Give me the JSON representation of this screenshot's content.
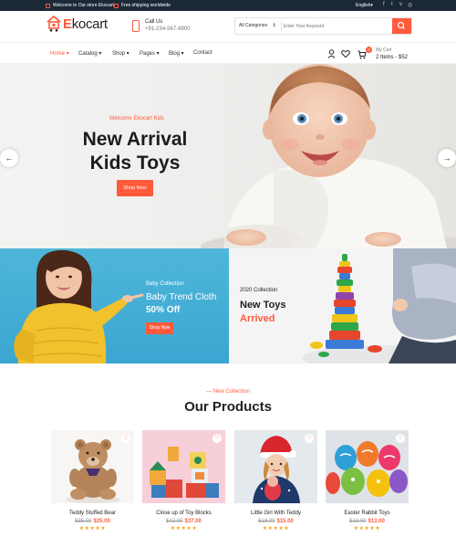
{
  "topbar": {
    "welcome": "Welcome to Our store Ekocart",
    "shipping": "Free shipping worldwide",
    "language": "English",
    "social_icons": [
      "facebook-icon",
      "twitter-icon",
      "vk-icon",
      "instagram-icon"
    ]
  },
  "header": {
    "logo_e": "E",
    "logo_rest": "kocart",
    "call_label": "Call Us",
    "phone": "+91-234-567-8900",
    "search": {
      "category": "All Categories",
      "placeholder": "Enter Your Keyword"
    }
  },
  "nav": {
    "items": [
      "Home",
      "Catalog",
      "Shop",
      "Pages",
      "Blog",
      "Contact"
    ],
    "active": "Home"
  },
  "cart": {
    "count": "2",
    "label": "My Cart",
    "amount": "2 Items - $52"
  },
  "hero": {
    "welcome": "Welcome Ekocart Kids",
    "title_line1": "New Arrival",
    "title_line2": "Kids Toys",
    "button": "Shop Now"
  },
  "banner_left": {
    "collection": "Baby Collection",
    "title": "Baby Trend Cloth",
    "offer": "50% Off",
    "button": "Shop Now"
  },
  "banner_right": {
    "collection": "2020 Collection",
    "title": "New Toys",
    "highlight": "Arrived"
  },
  "products_section": {
    "subtitle": "— New Collection",
    "title": "Our Products",
    "products": [
      {
        "name": "Teddy Stuffed Bear",
        "old_price": "$35.00",
        "price": "$25.00",
        "stars": "★★★★★"
      },
      {
        "name": "Close up of Toy Blocks",
        "old_price": "$42.00",
        "price": "$37.00",
        "stars": "★★★★★"
      },
      {
        "name": "Little Girl With Teddy",
        "old_price": "$18.00",
        "price": "$15.00",
        "stars": "★★★★★"
      },
      {
        "name": "Easter Rabbit Toys",
        "old_price": "$19.00",
        "price": "$13.00",
        "stars": "★★★★★"
      }
    ]
  },
  "colors": {
    "accent": "#ff5a3c",
    "topbar": "#1b2937",
    "banner_blue": "#3aa6d1",
    "star": "#f7a61b"
  }
}
